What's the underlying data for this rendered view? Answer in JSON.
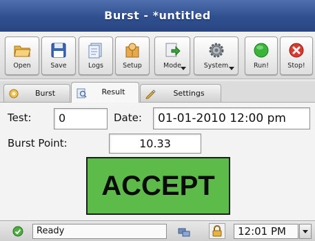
{
  "window": {
    "title": "Burst - *untitled"
  },
  "toolbar": {
    "buttons": [
      {
        "label": "Open",
        "icon": "folder-open-icon"
      },
      {
        "label": "Save",
        "icon": "floppy-save-icon"
      },
      {
        "label": "Logs",
        "icon": "logs-icon"
      },
      {
        "label": "Setup",
        "icon": "setup-icon"
      },
      {
        "label": "Mode",
        "icon": "mode-icon"
      },
      {
        "label": "System",
        "icon": "gear-icon"
      },
      {
        "label": "Run!",
        "icon": "run-icon"
      },
      {
        "label": "Stop!",
        "icon": "stop-icon"
      }
    ]
  },
  "tabs": [
    {
      "label": "Burst",
      "icon": "burst-icon"
    },
    {
      "label": "Result",
      "icon": "result-icon",
      "active": true
    },
    {
      "label": "Settings",
      "icon": "pencil-icon"
    }
  ],
  "result": {
    "test_label": "Test:",
    "test_value": "0",
    "date_label": "Date:",
    "date_value": "01-01-2010 12:00 pm",
    "burst_point_label": "Burst Point:",
    "burst_point_value": "10.33",
    "verdict": "ACCEPT"
  },
  "status": {
    "text": "Ready",
    "time": "12:01 PM"
  },
  "colors": {
    "title_bar": "#2f4f8f",
    "accept_green": "#5dbb4a",
    "run_green": "#39b53a",
    "stop_red": "#d93a2e"
  }
}
